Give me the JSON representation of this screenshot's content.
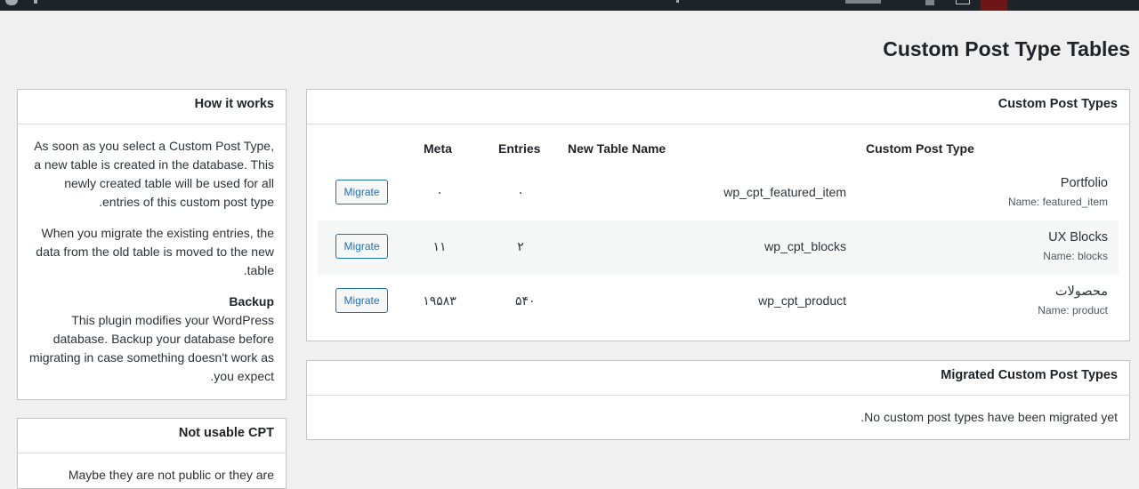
{
  "page": {
    "title": "Custom Post Type Tables"
  },
  "cpt_card": {
    "title": "Custom Post Types",
    "columns": {
      "meta": "Meta",
      "entries": "Entries",
      "new_table": "New Table Name",
      "cpt": "Custom Post Type"
    },
    "rows": [
      {
        "title": "Portfolio",
        "name": "Name: featured_item",
        "table": "wp_cpt_featured_item",
        "entries": "۰",
        "meta": "۰",
        "button": "Migrate"
      },
      {
        "title": "UX Blocks",
        "name": "Name: blocks",
        "table": "wp_cpt_blocks",
        "entries": "۲",
        "meta": "۱۱",
        "button": "Migrate"
      },
      {
        "title": "محصولات",
        "name": "Name: product",
        "table": "wp_cpt_product",
        "entries": "۵۴۰",
        "meta": "۱۹۵۸۳",
        "button": "Migrate"
      }
    ]
  },
  "migrated_card": {
    "title": "Migrated Custom Post Types",
    "empty": "No custom post types have been migrated yet."
  },
  "how_card": {
    "title": "How it works",
    "p1": "As soon as you select a Custom Post Type, a new table is created in the database. This newly created table will be used for all entries of this custom post type.",
    "p2": "When you migrate the existing entries, the data from the old table is moved to the new table.",
    "backup_title": "Backup",
    "backup_text": "This plugin modifies your WordPress database. Backup your database before migrating in case something doesn't work as you expect."
  },
  "notusable_card": {
    "title": "Not usable CPT",
    "text": "Maybe they are not public or they are"
  }
}
